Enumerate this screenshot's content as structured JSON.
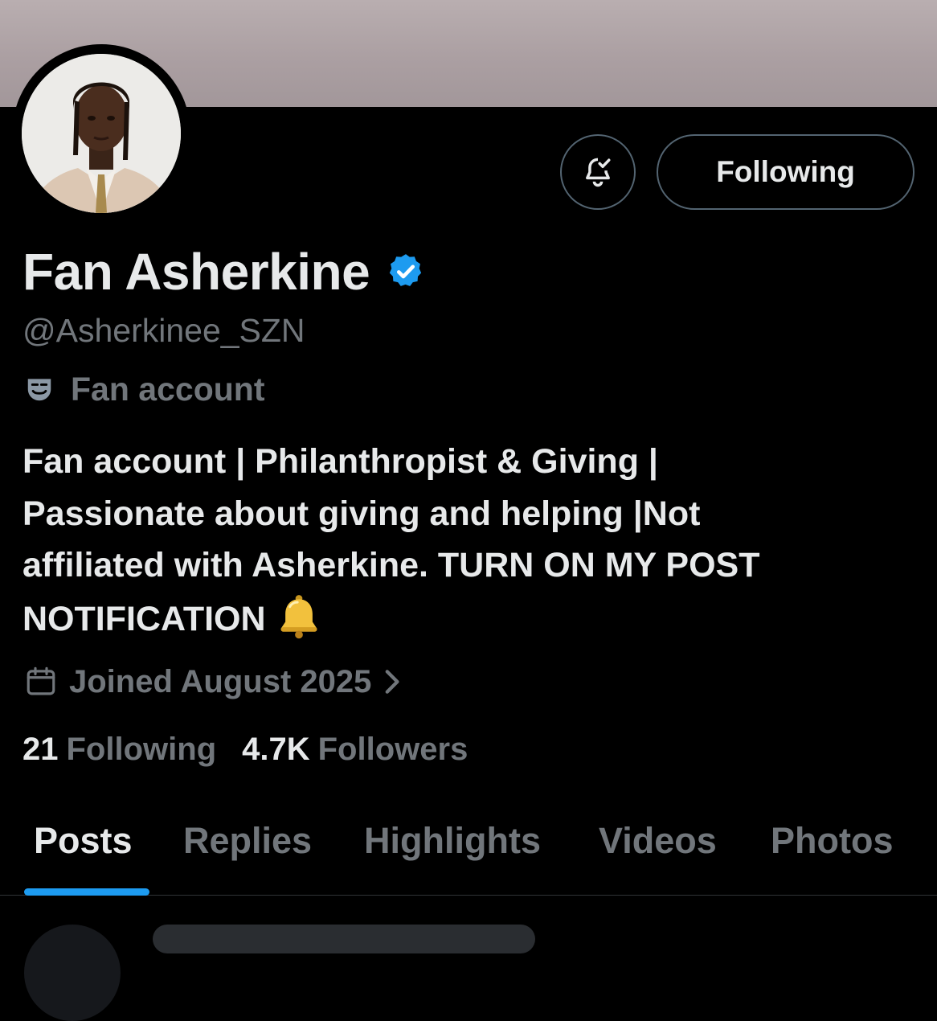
{
  "profile": {
    "display_name": "Fan Asherkine",
    "handle": "@Asherkinee_SZN",
    "label": "Fan account",
    "bio_lines": [
      "Fan account | Philanthropist & Giving |",
      "Passionate about giving and helping |Not",
      "affiliated with Asherkine. TURN ON MY POST",
      "NOTIFICATION"
    ],
    "joined": "Joined August 2025"
  },
  "actions": {
    "follow_label": "Following"
  },
  "stats": {
    "following_count": "21",
    "following_label": "Following",
    "followers_count": "4.7K",
    "followers_label": "Followers"
  },
  "tabs": [
    {
      "label": "Posts",
      "active": true
    },
    {
      "label": "Replies",
      "active": false
    },
    {
      "label": "Highlights",
      "active": false
    },
    {
      "label": "Videos",
      "active": false
    },
    {
      "label": "Photos",
      "active": false
    }
  ],
  "colors": {
    "background": "#000000",
    "text_primary": "#e7e9ea",
    "text_secondary": "#71767b",
    "accent": "#1d9bf0",
    "border": "#536471"
  },
  "icons": {
    "verified": "verified-badge-icon",
    "notifications": "bell-check-icon",
    "label": "theater-mask-icon",
    "joined": "calendar-icon",
    "bio_emoji": "bell-emoji-icon"
  }
}
